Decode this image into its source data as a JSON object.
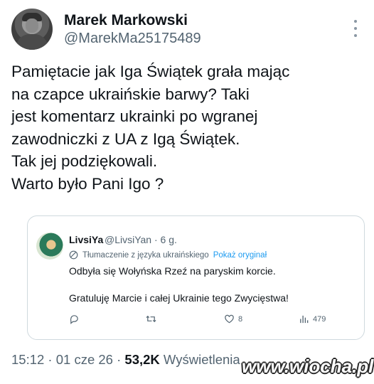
{
  "author": {
    "name": "Marek Markowski",
    "handle": "@MarekMa25175489",
    "avatar_icon": "avatar-soldier-portrait"
  },
  "tweet": {
    "lines": [
      "Pamiętacie jak Iga Świątek grała mając",
      "na czapce ukraińskie barwy?  Taki",
      "jest komentarz ukrainki po wgranej",
      "zawodniczki z UA z Igą Świątek.",
      "Tak jej podziękowali.",
      "Warto było Pani Igo ?"
    ]
  },
  "quote": {
    "name": "LivsiYa",
    "handle_time": "@LivsiYan · 6 g.",
    "translation_label": "Tłumaczenie z języka ukraińskiego",
    "show_original": "Pokaż oryginał",
    "line1": "Odbyła się Wołyńska Rzeź na paryskim korcie.",
    "line2": "Gratuluję Marcie i całej Ukrainie tego Zwycięstwa!",
    "actions": {
      "likes": "8",
      "views": "479"
    }
  },
  "meta": {
    "time_date": "15:12 · 01 cze 26 · ",
    "views_count": "53,2K",
    "views_label": " Wyświetlenia"
  },
  "watermark": "www.wiocha.pl",
  "colors": {
    "text": "#0f1419",
    "secondary": "#536471",
    "link": "#1d9bf0",
    "border": "#cfd9de"
  }
}
